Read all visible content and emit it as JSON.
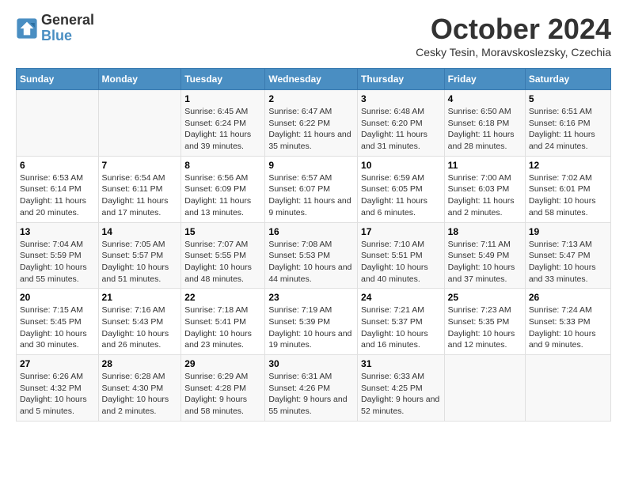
{
  "header": {
    "logo_line1": "General",
    "logo_line2": "Blue",
    "month_title": "October 2024",
    "location": "Cesky Tesin, Moravskoslezsky, Czechia"
  },
  "days_of_week": [
    "Sunday",
    "Monday",
    "Tuesday",
    "Wednesday",
    "Thursday",
    "Friday",
    "Saturday"
  ],
  "weeks": [
    [
      {
        "day": "",
        "detail": ""
      },
      {
        "day": "",
        "detail": ""
      },
      {
        "day": "1",
        "detail": "Sunrise: 6:45 AM\nSunset: 6:24 PM\nDaylight: 11 hours and 39 minutes."
      },
      {
        "day": "2",
        "detail": "Sunrise: 6:47 AM\nSunset: 6:22 PM\nDaylight: 11 hours and 35 minutes."
      },
      {
        "day": "3",
        "detail": "Sunrise: 6:48 AM\nSunset: 6:20 PM\nDaylight: 11 hours and 31 minutes."
      },
      {
        "day": "4",
        "detail": "Sunrise: 6:50 AM\nSunset: 6:18 PM\nDaylight: 11 hours and 28 minutes."
      },
      {
        "day": "5",
        "detail": "Sunrise: 6:51 AM\nSunset: 6:16 PM\nDaylight: 11 hours and 24 minutes."
      }
    ],
    [
      {
        "day": "6",
        "detail": "Sunrise: 6:53 AM\nSunset: 6:14 PM\nDaylight: 11 hours and 20 minutes."
      },
      {
        "day": "7",
        "detail": "Sunrise: 6:54 AM\nSunset: 6:11 PM\nDaylight: 11 hours and 17 minutes."
      },
      {
        "day": "8",
        "detail": "Sunrise: 6:56 AM\nSunset: 6:09 PM\nDaylight: 11 hours and 13 minutes."
      },
      {
        "day": "9",
        "detail": "Sunrise: 6:57 AM\nSunset: 6:07 PM\nDaylight: 11 hours and 9 minutes."
      },
      {
        "day": "10",
        "detail": "Sunrise: 6:59 AM\nSunset: 6:05 PM\nDaylight: 11 hours and 6 minutes."
      },
      {
        "day": "11",
        "detail": "Sunrise: 7:00 AM\nSunset: 6:03 PM\nDaylight: 11 hours and 2 minutes."
      },
      {
        "day": "12",
        "detail": "Sunrise: 7:02 AM\nSunset: 6:01 PM\nDaylight: 10 hours and 58 minutes."
      }
    ],
    [
      {
        "day": "13",
        "detail": "Sunrise: 7:04 AM\nSunset: 5:59 PM\nDaylight: 10 hours and 55 minutes."
      },
      {
        "day": "14",
        "detail": "Sunrise: 7:05 AM\nSunset: 5:57 PM\nDaylight: 10 hours and 51 minutes."
      },
      {
        "day": "15",
        "detail": "Sunrise: 7:07 AM\nSunset: 5:55 PM\nDaylight: 10 hours and 48 minutes."
      },
      {
        "day": "16",
        "detail": "Sunrise: 7:08 AM\nSunset: 5:53 PM\nDaylight: 10 hours and 44 minutes."
      },
      {
        "day": "17",
        "detail": "Sunrise: 7:10 AM\nSunset: 5:51 PM\nDaylight: 10 hours and 40 minutes."
      },
      {
        "day": "18",
        "detail": "Sunrise: 7:11 AM\nSunset: 5:49 PM\nDaylight: 10 hours and 37 minutes."
      },
      {
        "day": "19",
        "detail": "Sunrise: 7:13 AM\nSunset: 5:47 PM\nDaylight: 10 hours and 33 minutes."
      }
    ],
    [
      {
        "day": "20",
        "detail": "Sunrise: 7:15 AM\nSunset: 5:45 PM\nDaylight: 10 hours and 30 minutes."
      },
      {
        "day": "21",
        "detail": "Sunrise: 7:16 AM\nSunset: 5:43 PM\nDaylight: 10 hours and 26 minutes."
      },
      {
        "day": "22",
        "detail": "Sunrise: 7:18 AM\nSunset: 5:41 PM\nDaylight: 10 hours and 23 minutes."
      },
      {
        "day": "23",
        "detail": "Sunrise: 7:19 AM\nSunset: 5:39 PM\nDaylight: 10 hours and 19 minutes."
      },
      {
        "day": "24",
        "detail": "Sunrise: 7:21 AM\nSunset: 5:37 PM\nDaylight: 10 hours and 16 minutes."
      },
      {
        "day": "25",
        "detail": "Sunrise: 7:23 AM\nSunset: 5:35 PM\nDaylight: 10 hours and 12 minutes."
      },
      {
        "day": "26",
        "detail": "Sunrise: 7:24 AM\nSunset: 5:33 PM\nDaylight: 10 hours and 9 minutes."
      }
    ],
    [
      {
        "day": "27",
        "detail": "Sunrise: 6:26 AM\nSunset: 4:32 PM\nDaylight: 10 hours and 5 minutes."
      },
      {
        "day": "28",
        "detail": "Sunrise: 6:28 AM\nSunset: 4:30 PM\nDaylight: 10 hours and 2 minutes."
      },
      {
        "day": "29",
        "detail": "Sunrise: 6:29 AM\nSunset: 4:28 PM\nDaylight: 9 hours and 58 minutes."
      },
      {
        "day": "30",
        "detail": "Sunrise: 6:31 AM\nSunset: 4:26 PM\nDaylight: 9 hours and 55 minutes."
      },
      {
        "day": "31",
        "detail": "Sunrise: 6:33 AM\nSunset: 4:25 PM\nDaylight: 9 hours and 52 minutes."
      },
      {
        "day": "",
        "detail": ""
      },
      {
        "day": "",
        "detail": ""
      }
    ]
  ]
}
